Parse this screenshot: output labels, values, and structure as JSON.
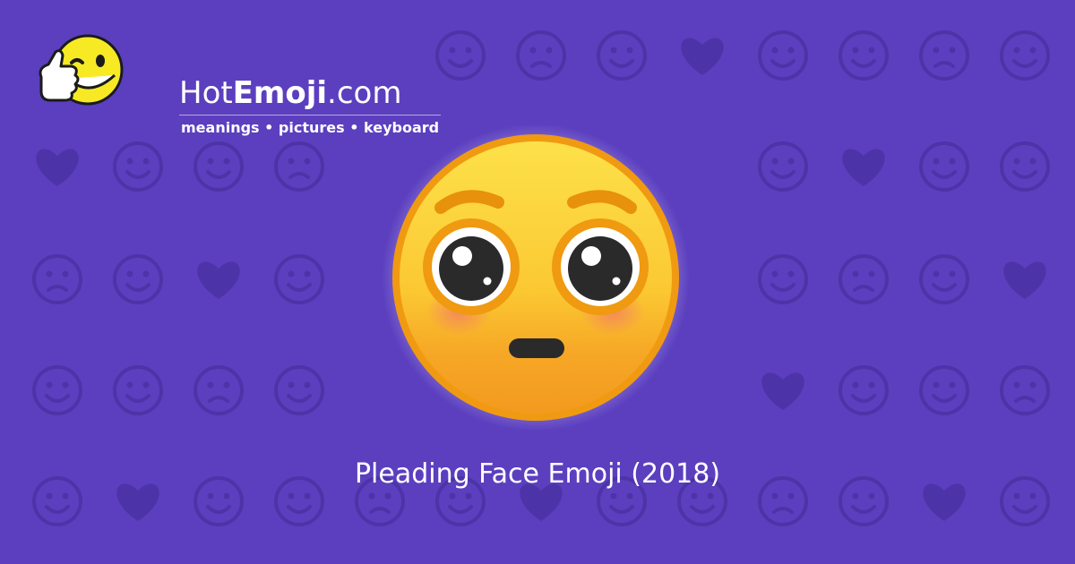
{
  "colors": {
    "background": "#5b3fbf",
    "pattern_icon": "#4d33a8",
    "emoji_face": "#fcd33a",
    "emoji_face_bottom": "#f4a224",
    "emoji_outline": "#f09a12",
    "text": "#ffffff"
  },
  "brand": {
    "name_prefix": "Hot",
    "name_bold": "Emoji",
    "name_suffix": ".com",
    "tagline": "meanings • pictures • keyboard",
    "logo_icon": "winking-thumbs-up-emoji-icon"
  },
  "hero": {
    "emoji_icon": "pleading-face-emoji-icon",
    "caption": "Pleading Face Emoji (2018)"
  },
  "background_pattern": {
    "icon_names": [
      "heart-eyes-icon",
      "winking-face-icon",
      "kissing-face-icon",
      "two-hearts-icon",
      "smiling-face-icon",
      "weary-face-icon",
      "ok-hand-icon",
      "neutral-face-icon",
      "eyes-icon",
      "smirking-face-icon",
      "relieved-face-icon",
      "grimacing-face-icon",
      "recycle-icon",
      "raising-hands-icon",
      "music-notes-icon",
      "sleeping-face-icon",
      "sad-face-icon",
      "grinning-face-icon",
      "sparkles-icon",
      "striped-heart-icon",
      "broken-heart-icon",
      "confused-face-icon",
      "tongue-out-face-icon",
      "worried-face-icon",
      "heart-arrow-icon",
      "revolving-hearts-icon",
      "heart-outline-icon",
      "monkey-icon",
      "screaming-face-icon",
      "devil-face-icon",
      "angry-face-icon",
      "left-arrow-icon",
      "fire-icon",
      "party-popper-icon",
      "rose-icon",
      "sun-icon",
      "flexed-biceps-icon",
      "check-mark-icon",
      "squinting-face-icon",
      "cat-face-icon",
      "waving-hand-icon",
      "mask-face-icon",
      "camera-icon",
      "beaming-face-icon",
      "blowing-kiss-icon"
    ]
  }
}
